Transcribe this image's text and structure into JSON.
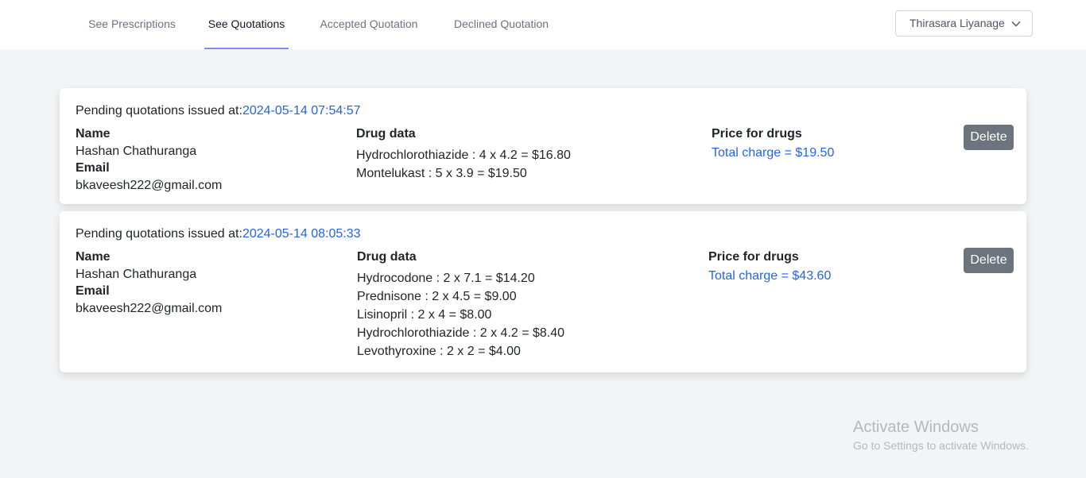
{
  "nav": {
    "tabs": [
      {
        "label": "See Prescriptions",
        "active": false
      },
      {
        "label": "See Quotations",
        "active": true
      },
      {
        "label": "Accepted Quotation",
        "active": false
      },
      {
        "label": "Declined Quotation",
        "active": false
      }
    ],
    "user_name": "Thirasara Liyanage",
    "accent_color": "#818cf8"
  },
  "quotations": [
    {
      "issued_prefix": "Pending quotations issued at:",
      "issued_at": "2024-05-14 07:54:57",
      "name_label": "Name",
      "name": "Hashan Chathuranga",
      "email_label": "Email",
      "email": "bkaveesh222@gmail.com",
      "drug_label": "Drug data",
      "drugs": [
        "Hydrochlorothiazide : 4 x 4.2 = $16.80",
        "Montelukast : 5 x 3.9 = $19.50"
      ],
      "price_label": "Price for drugs",
      "total": "Total charge = $19.50",
      "delete_label": "Delete"
    },
    {
      "issued_prefix": "Pending quotations issued at:",
      "issued_at": "2024-05-14 08:05:33",
      "name_label": "Name",
      "name": "Hashan Chathuranga",
      "email_label": "Email",
      "email": "bkaveesh222@gmail.com",
      "drug_label": "Drug data",
      "drugs": [
        "Hydrocodone : 2 x 7.1 = $14.20",
        "Prednisone : 2 x 4.5 = $9.00",
        "Lisinopril : 2 x 4 = $8.00",
        "Hydrochlorothiazide : 2 x 4.2 = $8.40",
        "Levothyroxine : 2 x 2 = $4.00"
      ],
      "price_label": "Price for drugs",
      "total": "Total charge = $43.60",
      "delete_label": "Delete"
    }
  ],
  "watermark": {
    "title": "Activate Windows",
    "subtitle": "Go to Settings to activate Windows."
  },
  "colors": {
    "link_blue": "#2563eb",
    "delete_gray": "#6c757d",
    "page_bg": "#f3f4f6"
  }
}
